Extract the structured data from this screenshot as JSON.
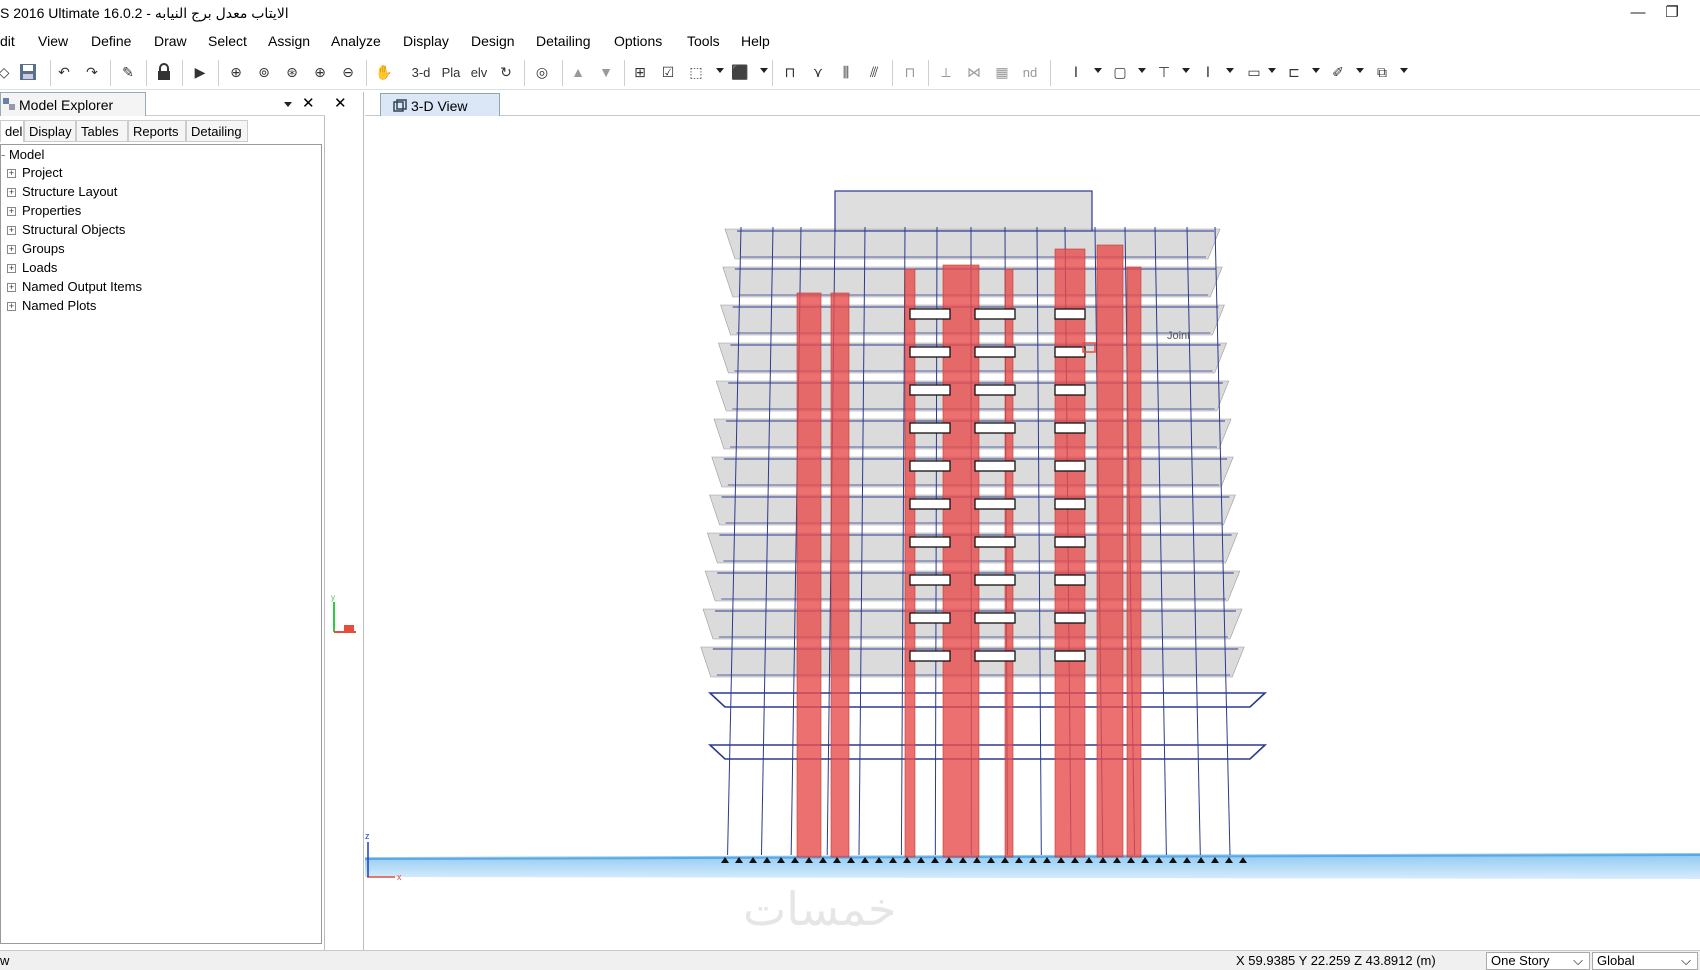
{
  "window": {
    "title": "S 2016 Ultimate 16.0.2 - الايتاب معدل برج النيابه",
    "minimize_glyph": "—",
    "restore_glyph": "❐"
  },
  "menu": [
    "dit",
    "View",
    "Define",
    "Draw",
    "Select",
    "Assign",
    "Analyze",
    "Display",
    "Design",
    "Detailing",
    "Options",
    "Tools",
    "Help"
  ],
  "toolbar": {
    "btn_3d": "3-d",
    "btn_plan": "Pla",
    "btn_elev": "elv",
    "btn_nd": "nd"
  },
  "model_explorer": {
    "title": "Model Explorer",
    "close_glyph": "✕",
    "tabs": [
      "del",
      "Display",
      "Tables",
      "Reports",
      "Detailing"
    ],
    "root": "Model",
    "items": [
      "Project",
      "Structure Layout",
      "Properties",
      "Structural Objects",
      "Groups",
      "Loads",
      "Named Output Items",
      "Named Plots"
    ]
  },
  "splitter": {
    "close_glyph": "✕"
  },
  "view": {
    "tab_label": "3-D View",
    "joint_label": "Joint",
    "axis_x": "x",
    "axis_z": "z",
    "axis_y": "y"
  },
  "watermark": "خمسات",
  "status": {
    "coords": "X 59.9385  Y 22.259  Z 43.8912 (m)",
    "story_combo": "One Story",
    "coord_combo": "Global",
    "left_text": "w"
  },
  "colors": {
    "frame": "#2b3a8f",
    "wall": "#e74c4c",
    "slab": "#bdbdbd",
    "ground": "#5aa9e6"
  }
}
